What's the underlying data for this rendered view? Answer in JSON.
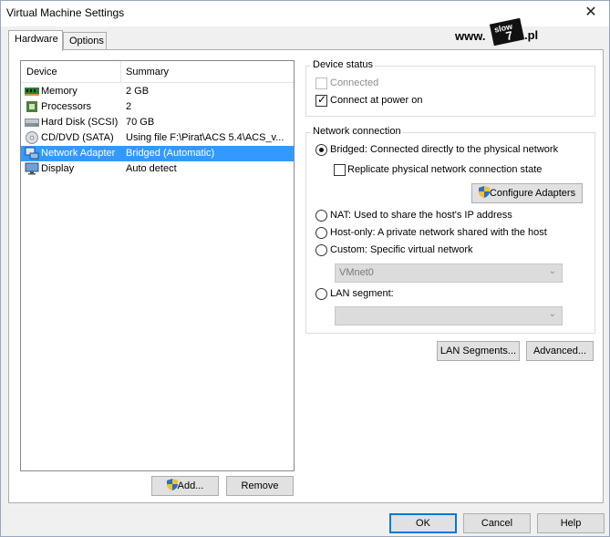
{
  "window": {
    "title": "Virtual Machine Settings",
    "close_glyph": "✕"
  },
  "tabs": [
    {
      "label": "Hardware",
      "active": true
    },
    {
      "label": "Options",
      "active": false
    }
  ],
  "logo": {
    "www": "www.",
    "badge_top": "slow",
    "badge_num": "7",
    "suffix": ".pl"
  },
  "device_list": {
    "headers": {
      "device": "Device",
      "summary": "Summary"
    },
    "rows": [
      {
        "device": "Memory",
        "summary": "2 GB",
        "icon": "memory-icon",
        "selected": false
      },
      {
        "device": "Processors",
        "summary": "2",
        "icon": "processor-icon",
        "selected": false
      },
      {
        "device": "Hard Disk (SCSI)",
        "summary": "70 GB",
        "icon": "hard-disk-icon",
        "selected": false
      },
      {
        "device": "CD/DVD (SATA)",
        "summary": "Using file F:\\Pirat\\ACS 5.4\\ACS_v...",
        "icon": "cd-dvd-icon",
        "selected": false
      },
      {
        "device": "Network Adapter",
        "summary": "Bridged (Automatic)",
        "icon": "network-adapter-icon",
        "selected": true
      },
      {
        "device": "Display",
        "summary": "Auto detect",
        "icon": "display-icon",
        "selected": false
      }
    ],
    "add_label": "Add...",
    "remove_label": "Remove"
  },
  "device_status": {
    "title": "Device status",
    "connected": {
      "label": "Connected",
      "checked": false,
      "disabled": true
    },
    "connect_at_power_on": {
      "label": "Connect at power on",
      "checked": true
    }
  },
  "network_connection": {
    "title": "Network connection",
    "bridged": {
      "label": "Bridged: Connected directly to the physical network",
      "selected": true
    },
    "replicate": {
      "label": "Replicate physical network connection state",
      "checked": false
    },
    "configure_adapters_label": "Configure Adapters",
    "nat": {
      "label": "NAT: Used to share the host's IP address",
      "selected": false
    },
    "host_only": {
      "label": "Host-only: A private network shared with the host",
      "selected": false
    },
    "custom": {
      "label": "Custom: Specific virtual network",
      "selected": false
    },
    "custom_select_value": "VMnet0",
    "lan_segment": {
      "label": "LAN segment:",
      "selected": false
    },
    "lan_segment_select_value": ""
  },
  "buttons": {
    "lan_segments": "LAN Segments...",
    "advanced": "Advanced...",
    "ok": "OK",
    "cancel": "Cancel",
    "help": "Help"
  },
  "colors": {
    "selection": "#3399ff",
    "default_button_border": "#0078d7"
  }
}
